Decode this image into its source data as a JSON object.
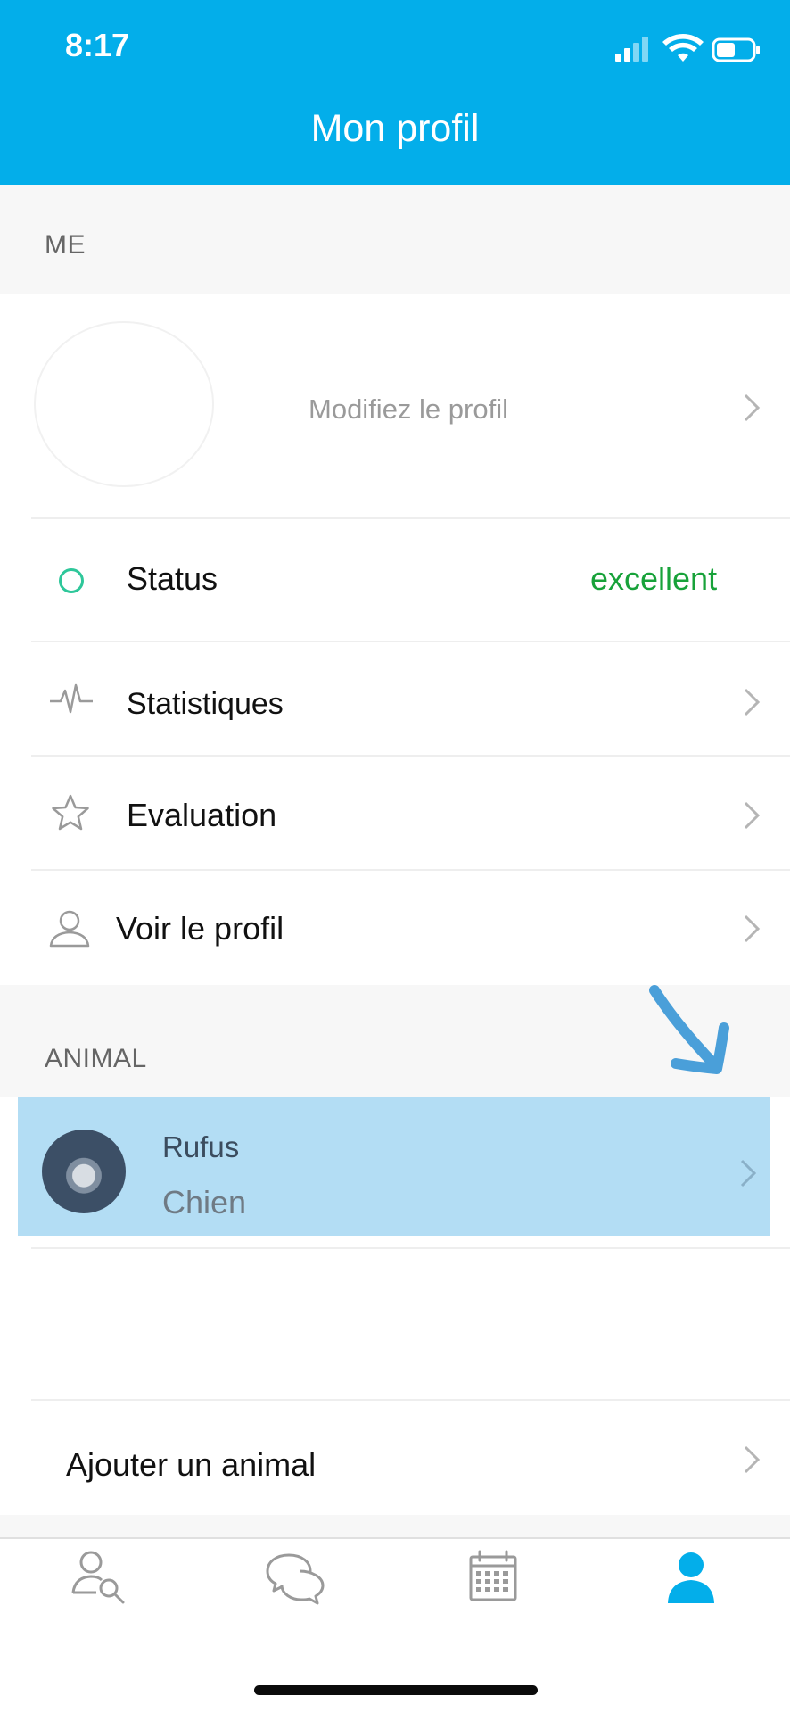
{
  "status_bar": {
    "time": "8:17"
  },
  "header": {
    "title": "Mon profil",
    "color": "#03aeea"
  },
  "me_section": {
    "label": "ME",
    "edit_profile": "Modifiez le profil",
    "rows": [
      {
        "label": "Status",
        "value": "excellent",
        "icon": "status-circle-icon"
      },
      {
        "label": "Statistiques",
        "icon": "pulse-icon"
      },
      {
        "label": "Evaluation",
        "icon": "star-icon"
      },
      {
        "label": "Voir le profil",
        "icon": "person-outline-icon"
      }
    ]
  },
  "animal_section": {
    "label": "ANIMAL",
    "pets": [
      {
        "name": "Rufus",
        "type": "Chien"
      }
    ],
    "add_label": "Ajouter un animal",
    "highlight_color": "#b3ddf4",
    "annotation": "arrow-pointer-icon"
  },
  "tab_bar": {
    "tabs": [
      {
        "icon": "search-person-icon",
        "active": false
      },
      {
        "icon": "chat-bubbles-icon",
        "active": false
      },
      {
        "icon": "calendar-icon",
        "active": false
      },
      {
        "icon": "profile-icon",
        "active": true
      }
    ],
    "active_color": "#03aeea",
    "inactive_color": "#9a9a9a"
  }
}
